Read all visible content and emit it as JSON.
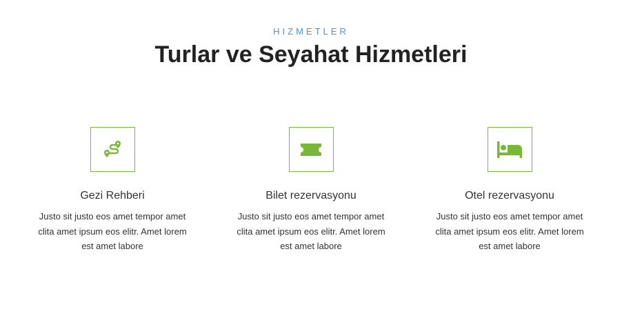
{
  "section": {
    "eyebrow": "HIZMETLER",
    "title": "Turlar ve Seyahat Hizmetleri"
  },
  "colors": {
    "accent": "#79b73a",
    "eyebrow": "#4a8fd9",
    "heading": "#222222"
  },
  "services": [
    {
      "icon": "route-icon",
      "title": "Gezi Rehberi",
      "text": "Justo sit justo eos amet tempor amet clita amet ipsum eos elitr. Amet lorem est amet labore"
    },
    {
      "icon": "ticket-icon",
      "title": "Bilet rezervasyonu",
      "text": "Justo sit justo eos amet tempor amet clita amet ipsum eos elitr. Amet lorem est amet labore"
    },
    {
      "icon": "bed-icon",
      "title": "Otel rezervasyonu",
      "text": "Justo sit justo eos amet tempor amet clita amet ipsum eos elitr. Amet lorem est amet labore"
    }
  ]
}
